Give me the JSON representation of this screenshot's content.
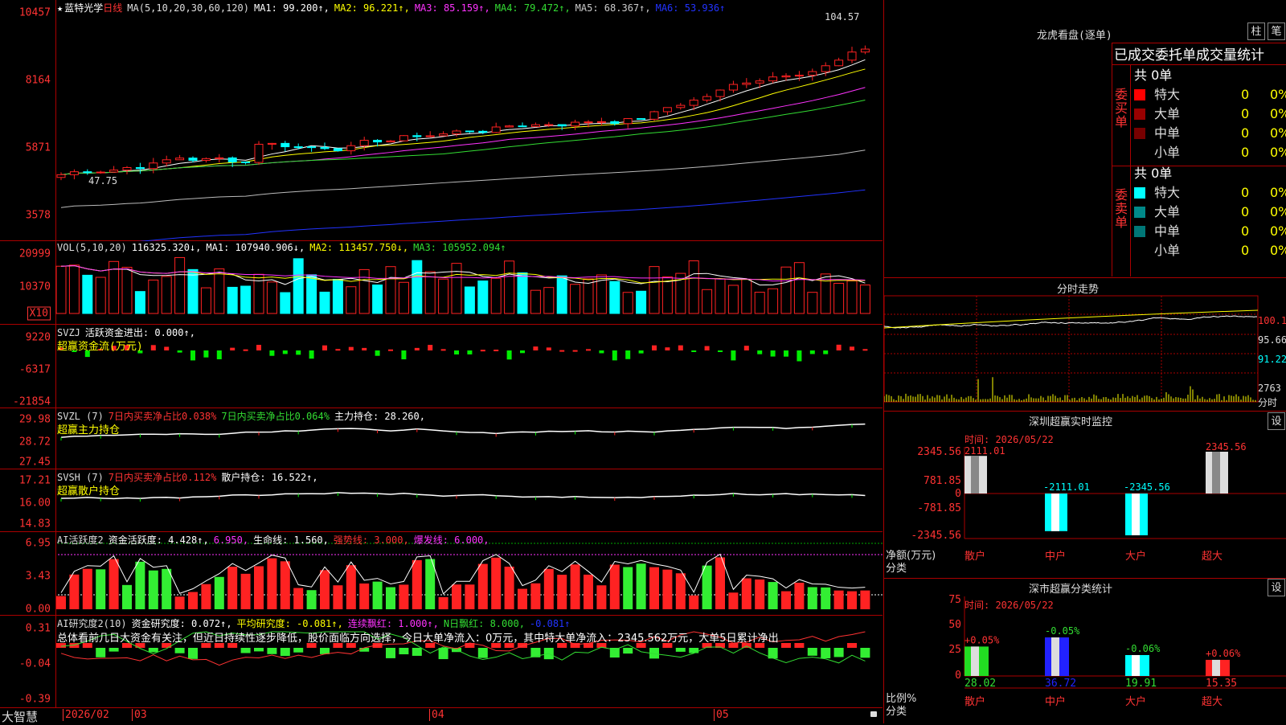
{
  "colors": {
    "up": "#ff2222",
    "down": "#00ffff",
    "ma1": "#ffffff",
    "ma2": "#ffff00",
    "ma3": "#ff33ff",
    "ma4": "#33dd33",
    "ma5": "#bbbbbb",
    "ma6": "#2233ff",
    "grid": "#aa0000"
  },
  "main": {
    "star": "★",
    "stock": "蓝特光学",
    "period": "日线",
    "ma_params": "MA(5,10,20,30,60,120)",
    "ma1": "MA1: 99.200↑,",
    "ma2": "MA2: 96.221↑,",
    "ma3": "MA3: 85.159↑,",
    "ma4": "MA4: 79.472↑,",
    "ma5": "MA5: 68.367↑,",
    "ma6": "MA6: 53.936↑",
    "y_labels": [
      "10457",
      "8164",
      "5871",
      "3578"
    ],
    "high_label": "104.57",
    "low_label": "47.75"
  },
  "vol": {
    "name": "VOL(5,10,20)",
    "value": "116325.320↓,",
    "ma1": "MA1: 107940.906↓,",
    "ma2": "MA2: 113457.750↓,",
    "ma3": "MA3: 105952.094↑",
    "y_labels": [
      "20999",
      "10370"
    ],
    "unit": "X10"
  },
  "svzj": {
    "name": "SVZJ",
    "line1": "活跃资金进出: 0.000↑,",
    "line2": "超赢资金流(万元)",
    "y_labels": [
      "9220",
      "-6317",
      "-21854"
    ]
  },
  "svzl": {
    "name": "SVZL (7)",
    "t1": "7日内买卖净占比0.038%",
    "t2": "7日内买卖净占比0.064%",
    "t3": "主力持仓: 28.260,",
    "line2": "超赢主力持仓",
    "y_labels": [
      "29.98",
      "28.72",
      "27.45"
    ]
  },
  "svsh": {
    "name": "SVSH (7)",
    "t1": "7日内买卖净占比0.112%",
    "t2": "散户持仓: 16.522↑,",
    "line2": "超赢散户持仓",
    "y_labels": [
      "17.21",
      "16.00",
      "14.83"
    ]
  },
  "ai1": {
    "name": "AI活跃度2",
    "t1": "资金活跃度: 4.428↑,",
    "t2": "6.950,",
    "t3": "生命线: 1.560,",
    "t4": "强势线: 3.000,",
    "t5": "爆发线: 6.000,",
    "y_labels": [
      "6.95",
      "3.43",
      "0.00"
    ]
  },
  "ai2": {
    "name": "AI研究度2(10)",
    "t1": "资金研究度: 0.072↑,",
    "t2": "平均研究度: -0.081↑,",
    "t3": "连续飘红: 1.000↑,",
    "t4": "N日飘红: 8.000,",
    "t5": "-0.081↑",
    "comment": "总体看前几日大资金有关注，但近日持续性逐步降低，股价面临方向选择，今日大单净流入：0万元，其中特大单净流入：2345.562万元，大单5日累计净出",
    "y_labels": [
      "0.31",
      "-0.04",
      "-0.39"
    ]
  },
  "bottom": {
    "brand": "大智慧",
    "date1": "2026/02",
    "m1": "03",
    "m2": "04",
    "m3": "05"
  },
  "right": {
    "lhb_title": "龙虎看盘(逐单)",
    "btn_bar": "柱",
    "btn_pen": "笔",
    "stat_title": "已成交委托单成交量统计",
    "buy_label": "委买单",
    "sell_label": "委卖单",
    "buy_total": "共 0单",
    "sell_total": "共 0单",
    "buy_rows": [
      {
        "name": "特大",
        "v": "0",
        "p": "0%",
        "c": "#ff0000"
      },
      {
        "name": "大单",
        "v": "0",
        "p": "0%",
        "c": "#990000"
      },
      {
        "name": "中单",
        "v": "0",
        "p": "0%",
        "c": "#770000"
      },
      {
        "name": "小单",
        "v": "0",
        "p": "0%",
        "c": "#000000"
      }
    ],
    "sell_rows": [
      {
        "name": "特大",
        "v": "0",
        "p": "0%",
        "c": "#00ffff"
      },
      {
        "name": "大单",
        "v": "0",
        "p": "0%",
        "c": "#008888"
      },
      {
        "name": "中单",
        "v": "0",
        "p": "0%",
        "c": "#007777"
      },
      {
        "name": "小单",
        "v": "0",
        "p": "0%",
        "c": "#000000"
      }
    ],
    "intraday_title": "分时走势",
    "intraday_y": [
      "100.1",
      "95.66",
      "91.22",
      "2763",
      "分时"
    ],
    "sz_title": "深圳超赢实时监控",
    "btn_set": "设",
    "sz_time": "时间: 2026/05/22",
    "sz_y": [
      "2345.56",
      "781.85",
      "0",
      "-781.85",
      "-2345.56"
    ],
    "sz_ylabel": "净额(万元)",
    "sz_xlabel": "分类",
    "sz_cats": [
      "散户",
      "中户",
      "大户",
      "超大"
    ],
    "sz_vals": [
      "2111.01",
      "-2111.01",
      "-2345.56",
      "2345.56"
    ],
    "cls_title": "深市超赢分类统计",
    "cls_time": "时间: 2026/05/22",
    "cls_y": [
      "75",
      "50",
      "25",
      "0"
    ],
    "cls_ylabel": "比例%",
    "cls_xlabel": "分类",
    "cls_cats": [
      "散户",
      "中户",
      "大户",
      "超大"
    ],
    "cls_vals": [
      "28.02",
      "36.72",
      "19.91",
      "15.35"
    ],
    "cls_deltas": [
      "+0.05%",
      "-0.05%",
      "-0.06%",
      "+0.06%"
    ]
  }
}
